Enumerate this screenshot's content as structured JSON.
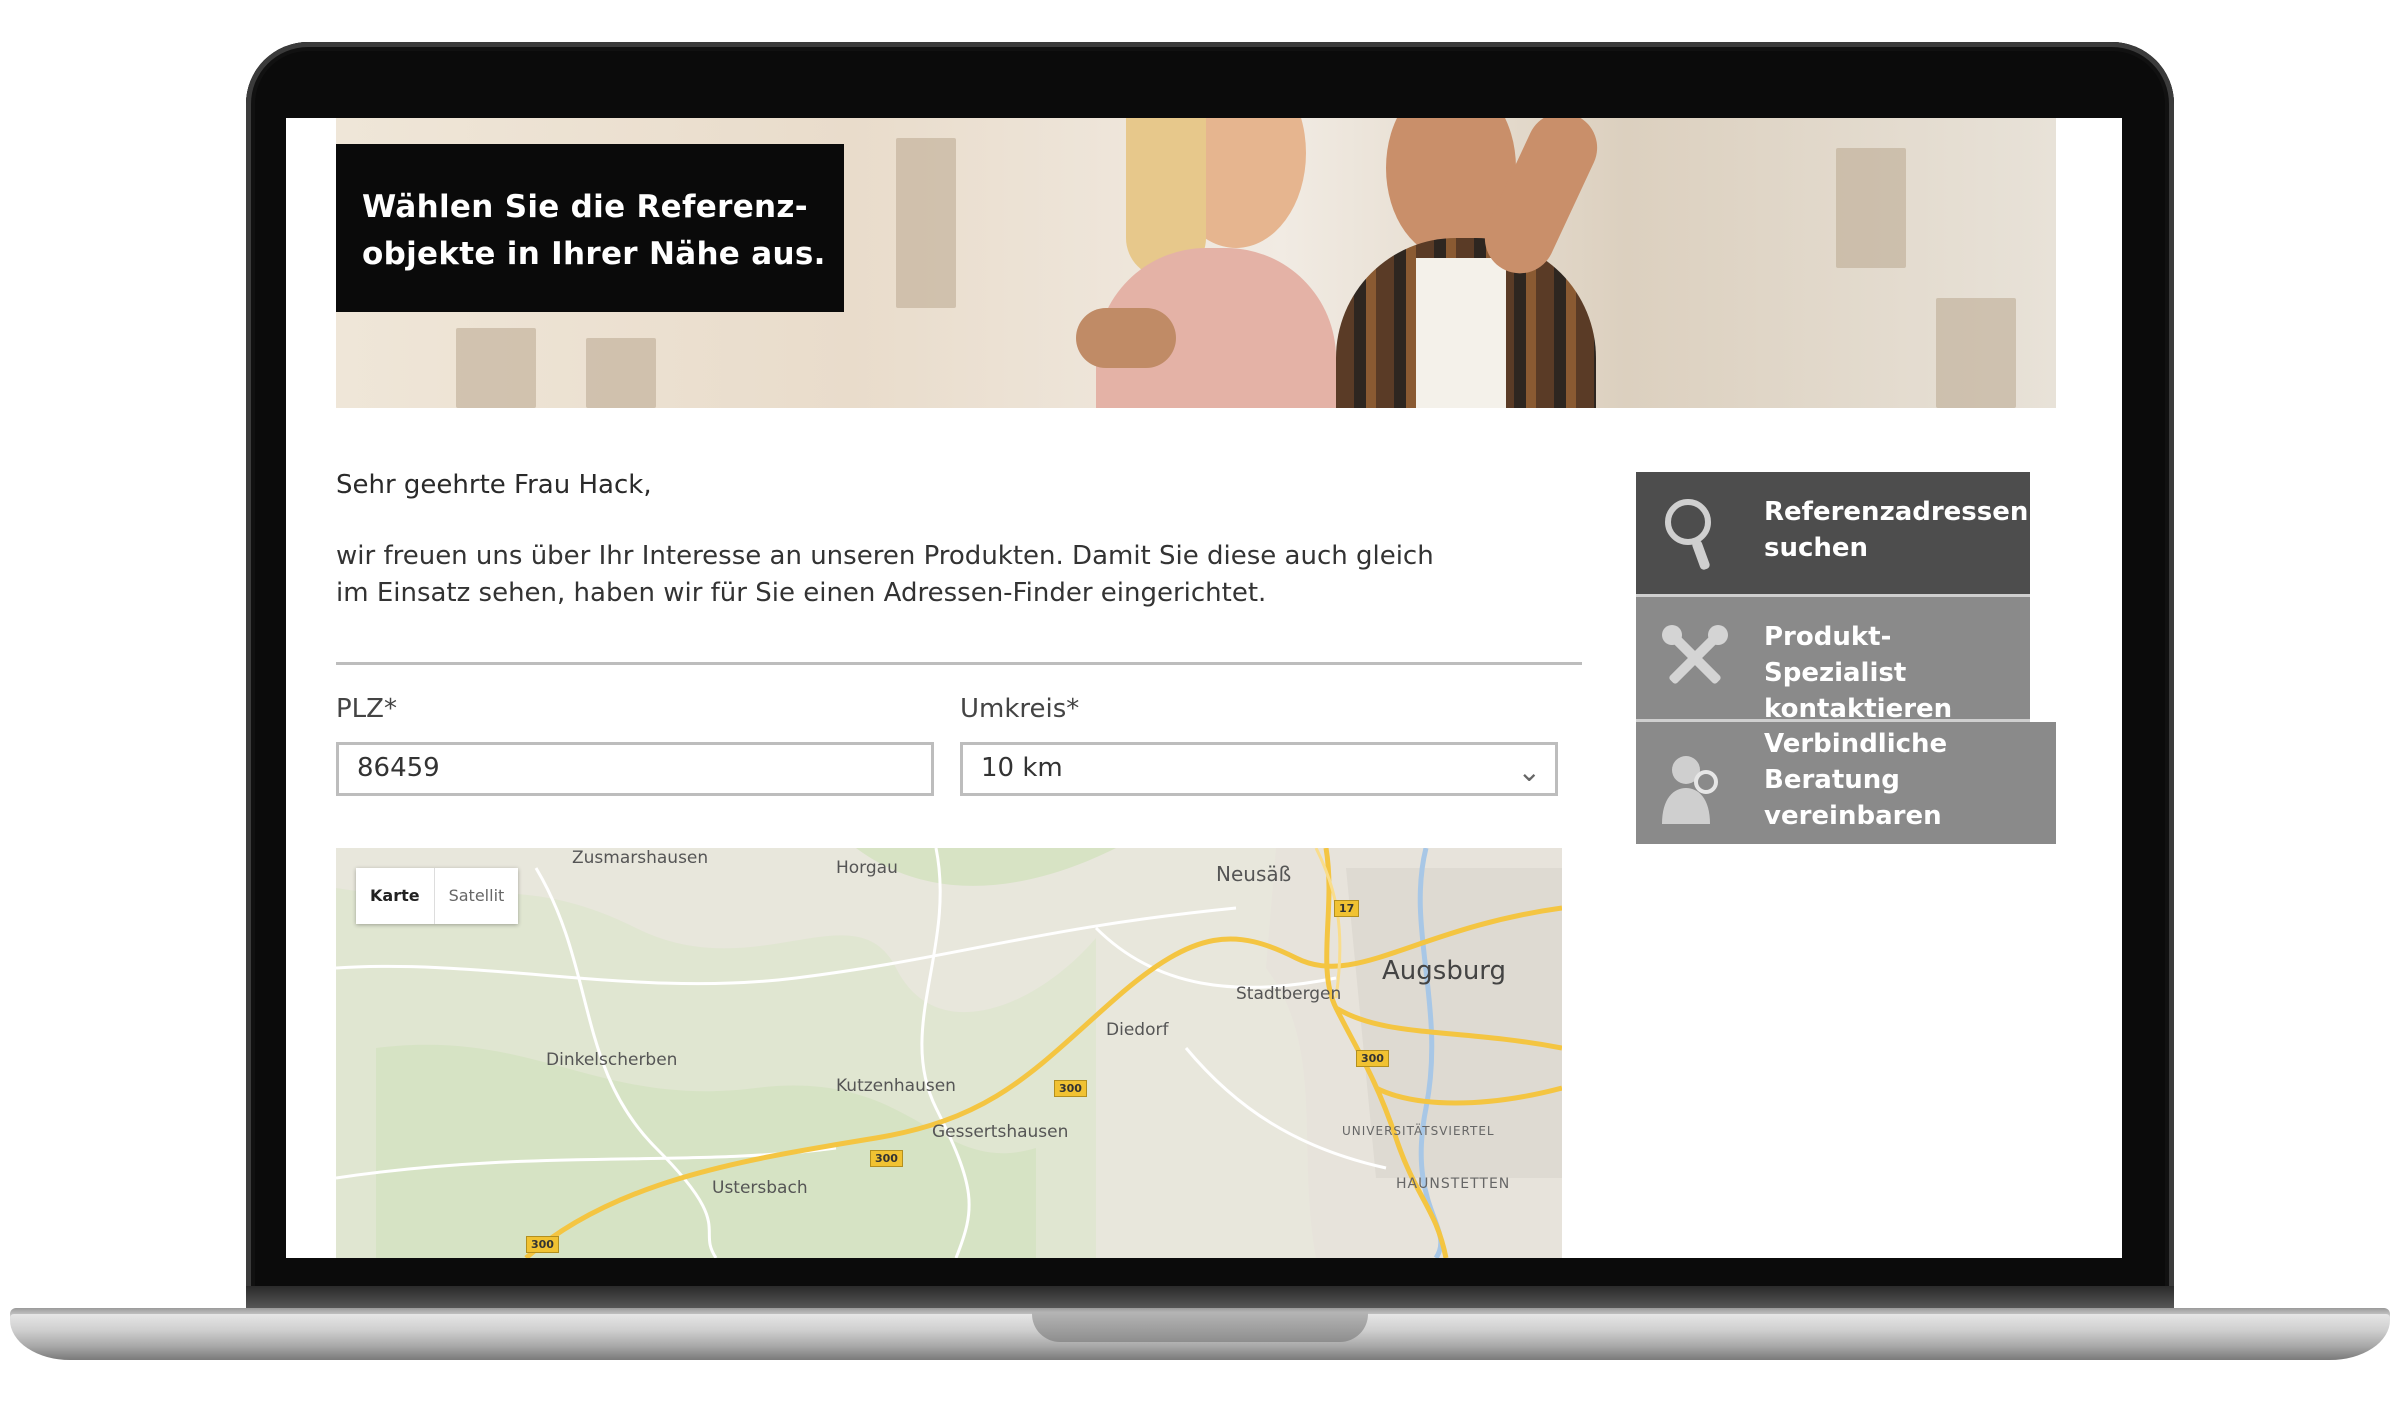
{
  "hero": {
    "line1": "Wählen Sie die Referenz-",
    "line2": "objekte in Ihrer Nähe aus."
  },
  "content": {
    "greeting": "Sehr geehrte Frau Hack,",
    "intro_line1": "wir freuen uns über Ihr Interesse an unseren Produkten. Damit Sie diese auch gleich",
    "intro_line2": "im Einsatz sehen, haben wir für Sie einen Adressen-Finder eingerichtet."
  },
  "form": {
    "plz_label": "PLZ*",
    "plz_value": "86459",
    "radius_label": "Umkreis*",
    "radius_value": "10 km"
  },
  "map": {
    "toggle_map": "Karte",
    "toggle_sat": "Satellit",
    "places": {
      "zusmarshausen": "Zusmarshausen",
      "horgau": "Horgau",
      "neusaess": "Neusäß",
      "augsburg": "Augsburg",
      "stadtbergen": "Stadtbergen",
      "diedorf": "Diedorf",
      "dinkelscherben": "Dinkelscherben",
      "kutzenhausen": "Kutzenhausen",
      "gessertshausen": "Gessertshausen",
      "ustersbach": "Ustersbach",
      "universitaetsviertel": "UNIVERSITÄTSVIERTEL",
      "haunstetten": "HAUNSTETTEN"
    },
    "roads": {
      "b17": "17",
      "b300_a": "300",
      "b300_b": "300",
      "b300_c": "300",
      "b300_d": "300"
    }
  },
  "sidebar": {
    "items": [
      {
        "line1": "Referenzadressen",
        "line2": "suchen",
        "icon": "magnifier-icon",
        "color": "#4d4d4d"
      },
      {
        "line1": "Produkt-Spezialist",
        "line2": "kontaktieren",
        "icon": "tools-icon",
        "color": "#8a8a8a"
      },
      {
        "line1": "Verbindliche",
        "line2": "Beratung",
        "line3": "vereinbaren",
        "icon": "consultant-icon",
        "color": "#8a8a8a"
      }
    ]
  }
}
